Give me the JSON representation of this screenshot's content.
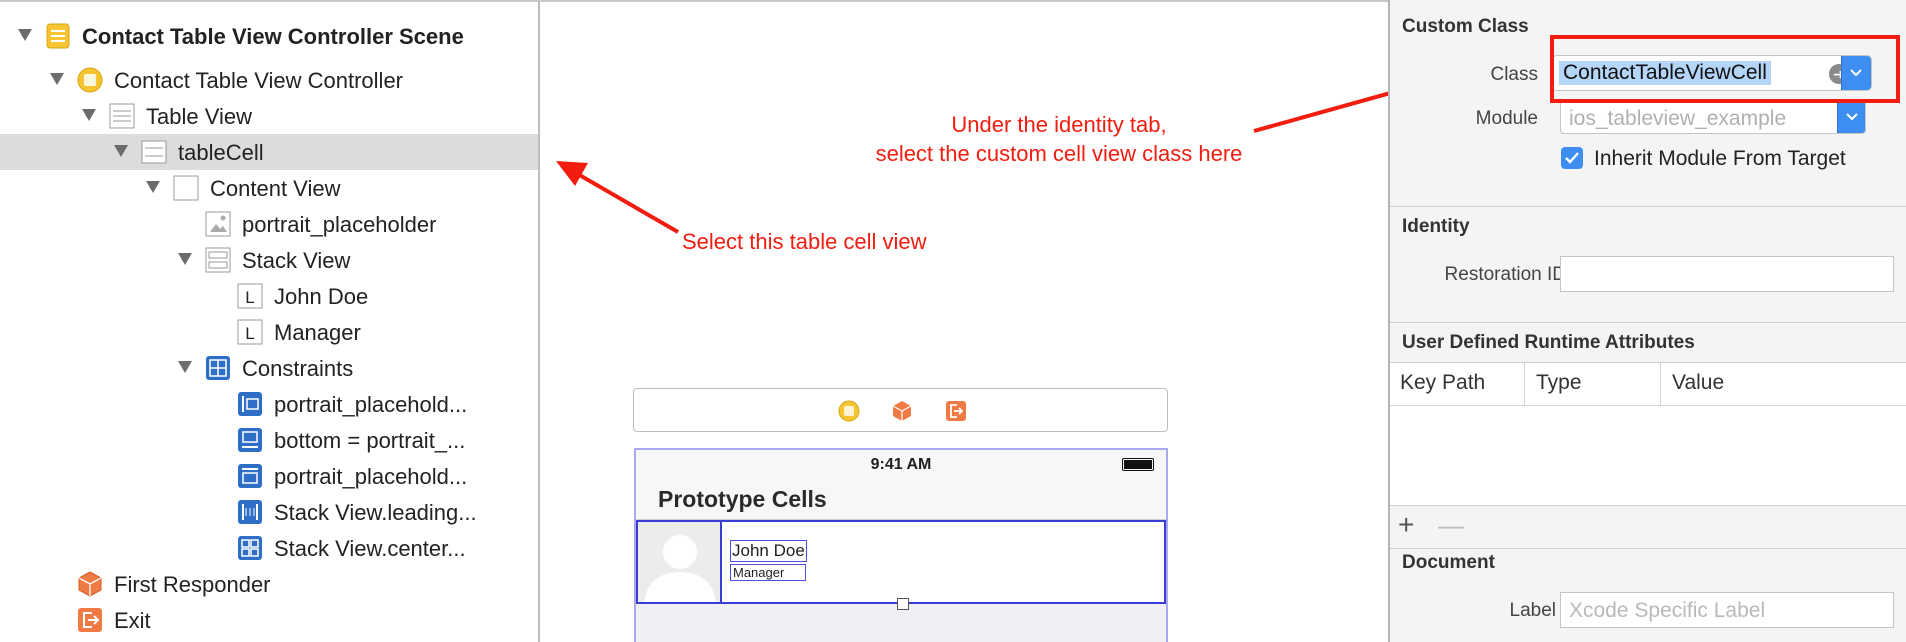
{
  "outline": {
    "scene_title": "Contact Table View Controller Scene",
    "items": [
      {
        "label": "Contact Table View Controller"
      },
      {
        "label": "Table View"
      },
      {
        "label": "tableCell"
      },
      {
        "label": "Content View"
      },
      {
        "label": "portrait_placeholder"
      },
      {
        "label": "Stack View"
      },
      {
        "label": "John Doe"
      },
      {
        "label": "Manager"
      },
      {
        "label": "Constraints"
      },
      {
        "label": "portrait_placehold..."
      },
      {
        "label": "bottom = portrait_..."
      },
      {
        "label": "portrait_placehold..."
      },
      {
        "label": "Stack View.leading..."
      },
      {
        "label": "Stack View.center..."
      },
      {
        "label": "First Responder"
      },
      {
        "label": "Exit"
      }
    ],
    "label_glyph": "L"
  },
  "canvas": {
    "annotation_identity": "Under the identity tab,",
    "annotation_identity_2": "select the custom cell view class here",
    "annotation_cell": "Select this table cell view",
    "phone": {
      "time": "9:41 AM",
      "nav_title": "Prototype Cells",
      "cell_name": "John Doe",
      "cell_role": "Manager"
    }
  },
  "inspector": {
    "custom_class": {
      "title": "Custom Class",
      "class_label": "Class",
      "class_value": "ContactTableViewCell",
      "module_label": "Module",
      "module_placeholder": "ios_tableview_example",
      "inherit_label": "Inherit Module From Target"
    },
    "identity": {
      "title": "Identity",
      "restoration_label": "Restoration ID",
      "restoration_value": ""
    },
    "runtime_attributes": {
      "title": "User Defined Runtime Attributes",
      "columns": [
        "Key Path",
        "Type",
        "Value"
      ],
      "add_glyph": "+",
      "remove_glyph": "—"
    },
    "document": {
      "title": "Document",
      "label_label": "Label",
      "label_placeholder": "Xcode Specific Label"
    }
  },
  "colors": {
    "annotation": "#f21d0f",
    "accent_blue": "#3d8ef0",
    "selection_blue": "#3b3bd6"
  }
}
